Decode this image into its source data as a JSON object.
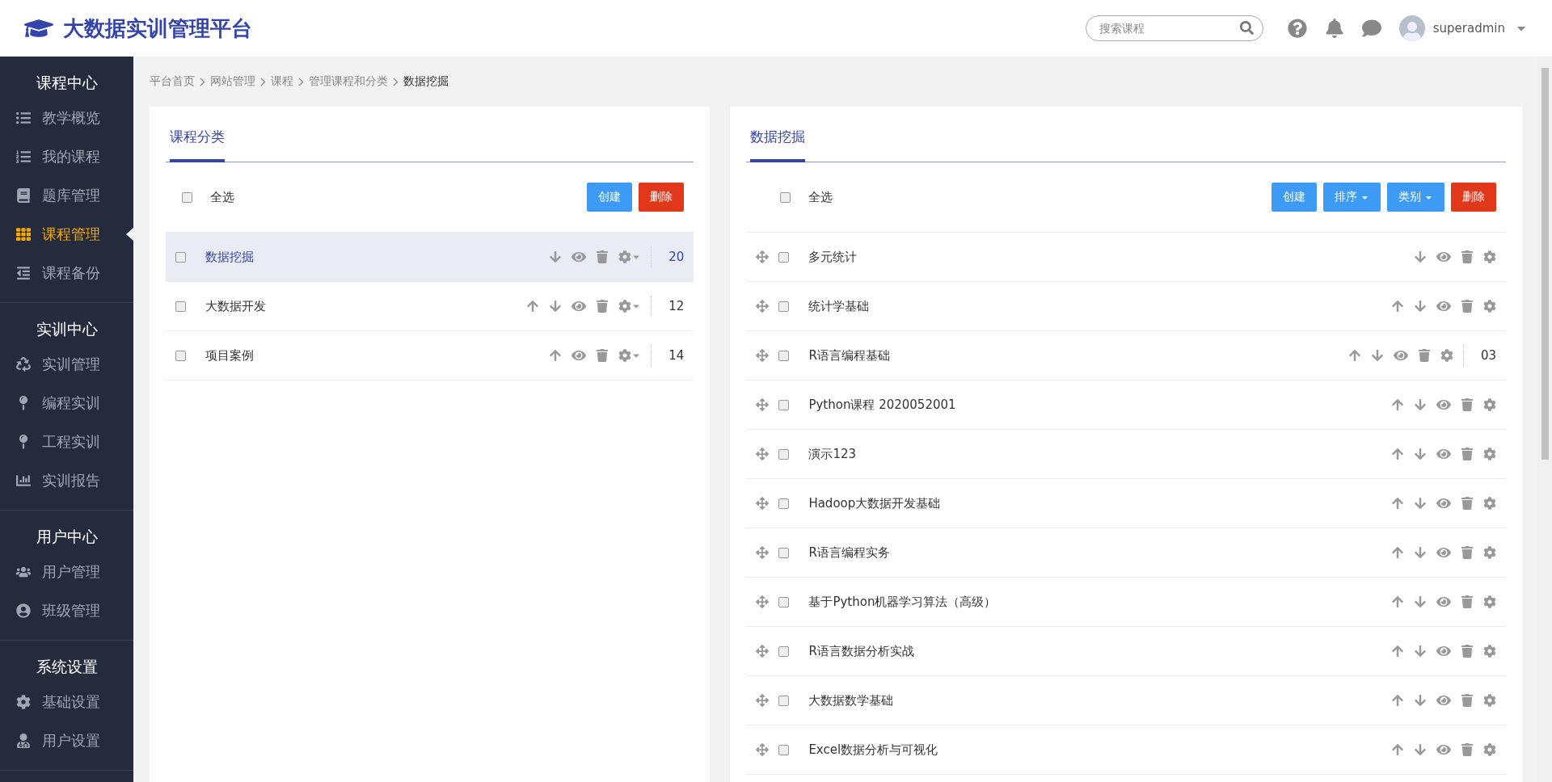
{
  "header": {
    "title": "大数据实训管理平台",
    "search": {
      "placeholder": "搜索课程"
    },
    "user": {
      "name": "superadmin"
    }
  },
  "sidebar": {
    "groups": [
      {
        "title": "课程中心",
        "items": [
          {
            "label": "教学概览",
            "selected": false
          },
          {
            "label": "我的课程",
            "selected": false
          },
          {
            "label": "题库管理",
            "selected": false
          },
          {
            "label": "课程管理",
            "selected": true
          },
          {
            "label": "课程备份",
            "selected": false
          }
        ]
      },
      {
        "title": "实训中心",
        "items": [
          {
            "label": "实训管理",
            "selected": false
          },
          {
            "label": "编程实训",
            "selected": false
          },
          {
            "label": "工程实训",
            "selected": false
          },
          {
            "label": "实训报告",
            "selected": false
          }
        ]
      },
      {
        "title": "用户中心",
        "items": [
          {
            "label": "用户管理",
            "selected": false
          },
          {
            "label": "班级管理",
            "selected": false
          }
        ]
      },
      {
        "title": "系统设置",
        "items": [
          {
            "label": "基础设置",
            "selected": false
          },
          {
            "label": "用户设置",
            "selected": false
          }
        ]
      }
    ]
  },
  "breadcrumb": [
    "平台首页",
    "网站管理",
    "课程",
    "管理课程和分类",
    "数据挖掘"
  ],
  "panels": [
    {
      "tab": "课程分类",
      "select_all": {
        "label": "全选",
        "checked": false
      },
      "draggable": false,
      "gear_menu": true,
      "buttons": [
        {
          "label": "创建",
          "kind": "primary",
          "dropdown": false
        },
        {
          "label": "删除",
          "kind": "danger",
          "dropdown": false
        }
      ],
      "rows": [
        {
          "name": "数据挖掘",
          "checked": false,
          "selected": true,
          "up": false,
          "down": true,
          "count": "20"
        },
        {
          "name": "大数据开发",
          "checked": false,
          "selected": false,
          "up": true,
          "down": true,
          "count": "12"
        },
        {
          "name": "项目案例",
          "checked": false,
          "selected": false,
          "up": true,
          "down": false,
          "count": "14"
        }
      ]
    },
    {
      "tab": "数据挖掘",
      "select_all": {
        "label": "全选",
        "checked": false
      },
      "draggable": true,
      "gear_menu": false,
      "buttons": [
        {
          "label": "创建",
          "kind": "primary",
          "dropdown": false
        },
        {
          "label": "排序",
          "kind": "primary",
          "dropdown": true
        },
        {
          "label": "类别",
          "kind": "primary",
          "dropdown": true
        },
        {
          "label": "删除",
          "kind": "danger",
          "dropdown": false
        }
      ],
      "rows": [
        {
          "name": "多元统计",
          "checked": false,
          "selected": false,
          "up": false,
          "down": true
        },
        {
          "name": "统计学基础",
          "checked": false,
          "selected": false,
          "up": true,
          "down": true
        },
        {
          "name": "R语言编程基础",
          "checked": false,
          "selected": false,
          "up": true,
          "down": true,
          "count": "03"
        },
        {
          "name": "Python课程 2020052001",
          "checked": false,
          "selected": false,
          "up": true,
          "down": true
        },
        {
          "name": "演示123",
          "checked": false,
          "selected": false,
          "up": true,
          "down": true
        },
        {
          "name": "Hadoop大数据开发基础",
          "checked": false,
          "selected": false,
          "up": true,
          "down": true
        },
        {
          "name": "R语言编程实务",
          "checked": false,
          "selected": false,
          "up": true,
          "down": true
        },
        {
          "name": "基于Python机器学习算法（高级）",
          "checked": false,
          "selected": false,
          "up": true,
          "down": true
        },
        {
          "name": "R语言数据分析实战",
          "checked": false,
          "selected": false,
          "up": true,
          "down": true
        },
        {
          "name": "大数据数学基础",
          "checked": false,
          "selected": false,
          "up": true,
          "down": true
        },
        {
          "name": "Excel数据分析与可视化",
          "checked": false,
          "selected": false,
          "up": true,
          "down": true
        }
      ]
    }
  ]
}
